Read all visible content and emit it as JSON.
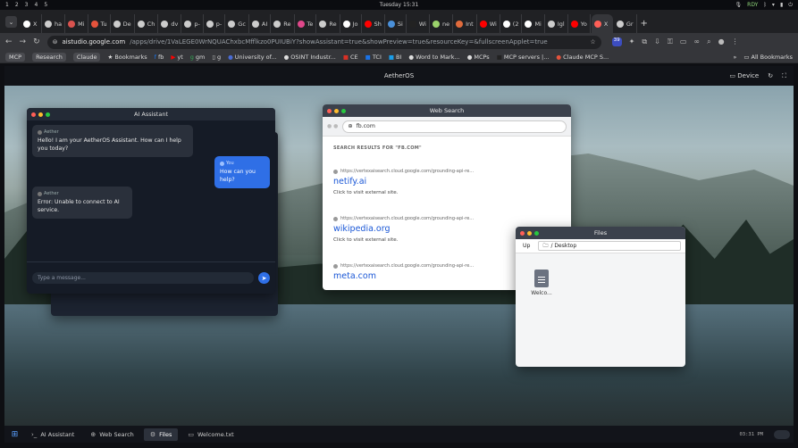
{
  "system_bar": {
    "workspaces": [
      "1",
      "2",
      "3",
      "4",
      "5"
    ],
    "clock": "Tuesday 15:31",
    "status": "RDY"
  },
  "browser": {
    "tabs": [
      {
        "label": "X",
        "color": "#ffffff"
      },
      {
        "label": "ha",
        "color": "#cccccc"
      },
      {
        "label": "Mi",
        "color": "#d9534f"
      },
      {
        "label": "Tu",
        "color": "#e5533c"
      },
      {
        "label": "De",
        "color": "#cccccc"
      },
      {
        "label": "Ch",
        "color": "#cccccc"
      },
      {
        "label": "dv",
        "color": "#cccccc"
      },
      {
        "label": "p-",
        "color": "#cccccc"
      },
      {
        "label": "p-",
        "color": "#cccccc"
      },
      {
        "label": "Gc",
        "color": "#cccccc"
      },
      {
        "label": "AI",
        "color": "#cccccc"
      },
      {
        "label": "Re",
        "color": "#cccccc"
      },
      {
        "label": "Te",
        "color": "#e0488b"
      },
      {
        "label": "Re",
        "color": "#cccccc"
      },
      {
        "label": "Jo",
        "color": "#ffffff"
      },
      {
        "label": "Sh",
        "color": "#ff0000"
      },
      {
        "label": "Si",
        "color": "#4a90d9"
      },
      {
        "label": "Wi",
        "color": "#222222"
      },
      {
        "label": "ne",
        "color": "#9bd36b"
      },
      {
        "label": "Int",
        "color": "#e06b3c"
      },
      {
        "label": "Wi",
        "color": "#ff0000"
      },
      {
        "label": "(2",
        "color": "#ffffff"
      },
      {
        "label": "Mi",
        "color": "#ffffff"
      },
      {
        "label": "Igl",
        "color": "#cccccc"
      },
      {
        "label": "Yo",
        "color": "#ff0000"
      }
    ],
    "active_tab": {
      "label": "X",
      "color": "#ff5f57"
    },
    "last_tab": {
      "label": "Gr",
      "color": "#cccccc"
    },
    "new_tab": "+",
    "url_host": "aistudio.google.com",
    "url_path": "/apps/drive/1VaLEGE0WrNQUAChxbcMfflkzo0PUIUBiY?showAssistant=true&showPreview=true&resourceKey=&fullscreenApplet=true",
    "extension_badge": "39",
    "bookmarks": [
      {
        "label": "MCP",
        "chip": true
      },
      {
        "label": "Research",
        "chip": true
      },
      {
        "label": "Claude",
        "chip": true
      },
      {
        "label": "Bookmarks",
        "icon": "★",
        "color": "#dddddd"
      },
      {
        "label": "fb",
        "icon": "f",
        "color": "#1877f2"
      },
      {
        "label": "yt",
        "icon": "▶",
        "color": "#ff0000"
      },
      {
        "label": "gm",
        "icon": "g",
        "color": "#34a853"
      },
      {
        "label": "g",
        "icon": "▯",
        "color": "#cccccc"
      },
      {
        "label": "University of...",
        "icon": "●",
        "color": "#4a6cd4"
      },
      {
        "label": "OSINT Industr...",
        "icon": "●",
        "color": "#dddddd"
      },
      {
        "label": "CE",
        "icon": "■",
        "color": "#d93025"
      },
      {
        "label": "TCI",
        "icon": "■",
        "color": "#1a73e8"
      },
      {
        "label": "BI",
        "icon": "■",
        "color": "#1a9de8"
      },
      {
        "label": "Word to Mark...",
        "icon": "●",
        "color": "#dddddd"
      },
      {
        "label": "MCPs",
        "icon": "●",
        "color": "#dddddd"
      },
      {
        "label": "MCP servers |...",
        "icon": "■",
        "color": "#222222"
      },
      {
        "label": "Claude MCP S...",
        "icon": "●",
        "color": "#e5533c"
      }
    ],
    "all_bookmarks": "All Bookmarks"
  },
  "app": {
    "title": "AetherOS",
    "device_label": "Device"
  },
  "ai_window": {
    "title": "AI Assistant",
    "messages": [
      {
        "sender": "Aether",
        "text": "Hello! I am your AetherOS Assistant. How can I help you today?"
      },
      {
        "sender": "You",
        "text": "How can you help?"
      },
      {
        "sender": "Aether",
        "text": "Error: Unable to connect to AI service."
      }
    ],
    "input_placeholder": "Type a message..."
  },
  "web_window": {
    "title": "Web Search",
    "url": "fb.com",
    "heading": "SEARCH RESULTS FOR \"FB.COM\"",
    "results": [
      {
        "source": "https://vertexaisearch.cloud.google.com/grounding-api-re...",
        "title": "netify.ai",
        "desc": "Click to visit external site."
      },
      {
        "source": "https://vertexaisearch.cloud.google.com/grounding-api-re...",
        "title": "wikipedia.org",
        "desc": "Click to visit external site."
      },
      {
        "source": "https://vertexaisearch.cloud.google.com/grounding-api-re...",
        "title": "meta.com",
        "desc": ""
      }
    ]
  },
  "files_window": {
    "title": "Files",
    "up_label": "Up",
    "path": "/ Desktop",
    "items": [
      {
        "name": "Welco..."
      }
    ]
  },
  "taskbar": {
    "items": [
      {
        "label": "AI Assistant",
        "icon": "terminal-icon"
      },
      {
        "label": "Web Search",
        "icon": "globe-icon"
      },
      {
        "label": "Files",
        "icon": "folder-icon"
      },
      {
        "label": "Welcome.txt",
        "icon": "document-icon"
      }
    ],
    "time": "03:31 PM"
  }
}
